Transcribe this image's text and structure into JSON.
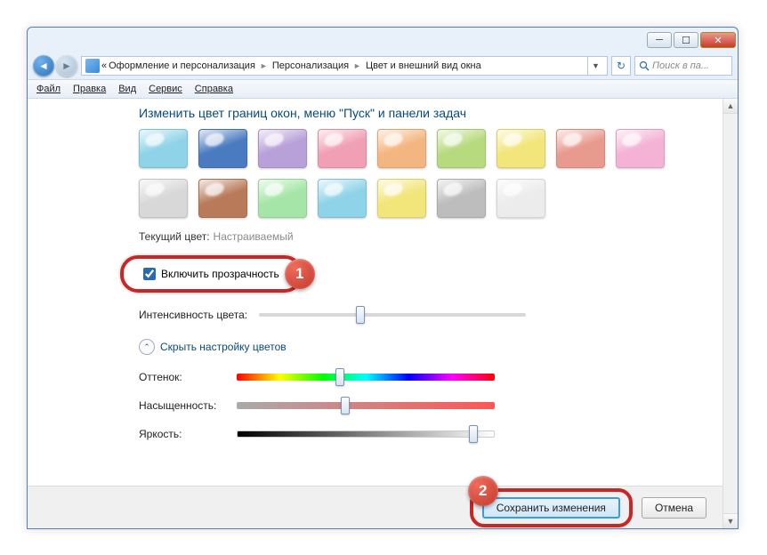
{
  "titlebar": {
    "min": "─",
    "max": "☐",
    "close": "✕"
  },
  "nav": {
    "back": "◄",
    "fwd": "►",
    "prefix": "«",
    "crumb1": "Оформление и персонализация",
    "crumb2": "Персонализация",
    "crumb3": "Цвет и внешний вид окна",
    "sep": "►",
    "refresh": "↻",
    "search_placeholder": "Поиск в па..."
  },
  "menu": {
    "file": "Файл",
    "edit": "Правка",
    "view": "Вид",
    "tools": "Сервис",
    "help": "Справка"
  },
  "heading": "Изменить цвет границ окон, меню \"Пуск\" и панели задач",
  "swatches_row1": [
    "#8fd3e8",
    "#4a7bc0",
    "#b8a0d8",
    "#f19fb4",
    "#f4b680",
    "#b8da7e",
    "#f2e57a",
    "#e89a8e"
  ],
  "swatches_row2": [
    "#f4b2d4",
    "#d8d8d8",
    "#b97a5a",
    "#a5e6a8",
    "#8fd3e8",
    "#f2e57a",
    "#bdbdbd",
    "#ececec"
  ],
  "current_color_label": "Текущий цвет:",
  "current_color_value": "Настраиваемый",
  "transparency_label": "Включить прозрачность",
  "intensity_label": "Интенсивность цвета:",
  "hide_mixer": "Скрыть настройку цветов",
  "hue_label": "Оттенок:",
  "sat_label": "Насыщенность:",
  "bri_label": "Яркость:",
  "sliders": {
    "intensity": 38,
    "hue": 40,
    "sat": 42,
    "bri": 92
  },
  "save_label": "Сохранить изменения",
  "cancel_label": "Отмена",
  "badge1": "1",
  "badge2": "2",
  "chev_up": "⌃"
}
